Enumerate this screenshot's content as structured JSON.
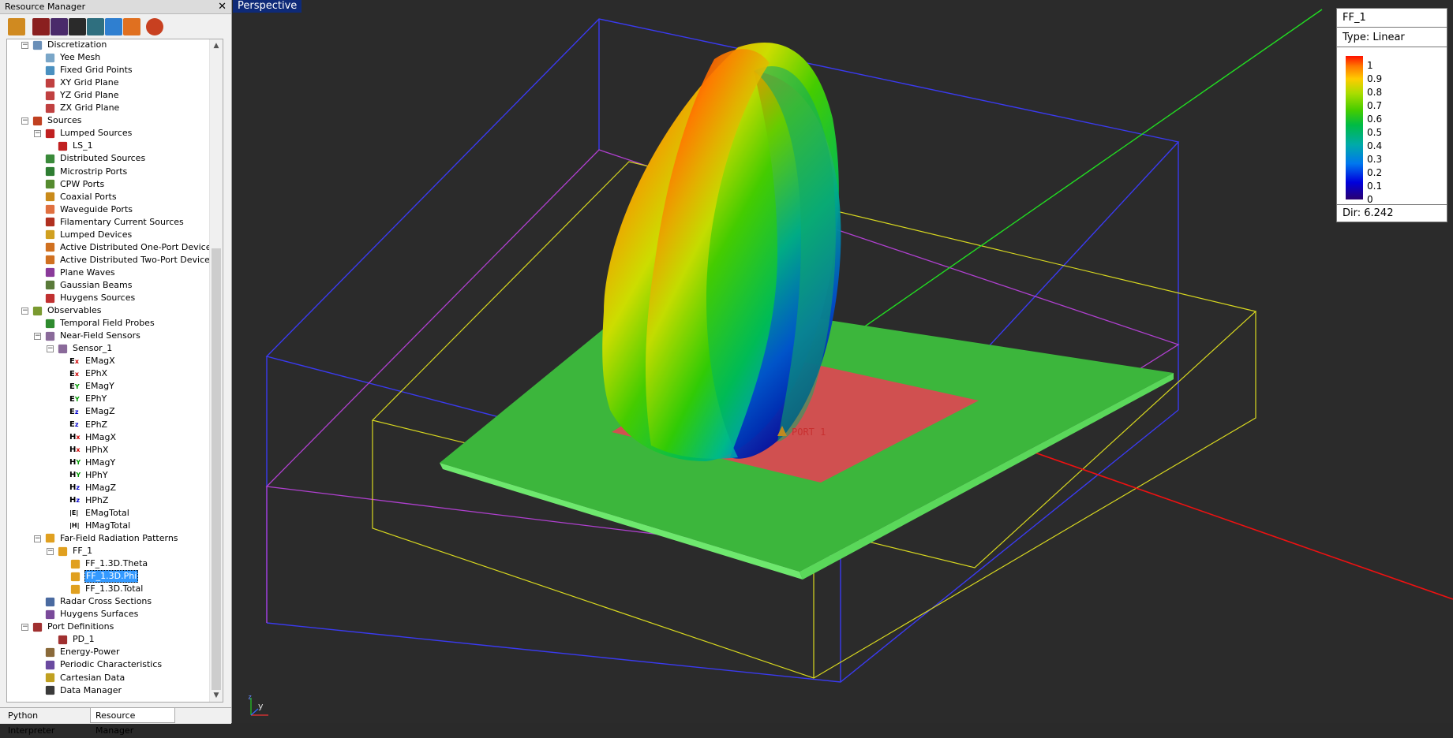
{
  "panel": {
    "title": "Resource Manager",
    "close_glyph": "✕"
  },
  "toolbar": [
    {
      "icon": "open-project-icon"
    },
    {
      "icon": "geometry-view-icon"
    },
    {
      "icon": "mesh-view-icon"
    },
    {
      "icon": "results-view-icon"
    },
    {
      "icon": "network-icon"
    },
    {
      "icon": "scatter-icon"
    },
    {
      "icon": "path-icon"
    },
    {
      "icon": "target-icon"
    }
  ],
  "tree": [
    {
      "depth": 1,
      "label": "Discretization",
      "icon": "grid-icon",
      "exp": "-"
    },
    {
      "depth": 2,
      "label": "Yee Mesh",
      "icon": "yee-mesh-icon"
    },
    {
      "depth": 2,
      "label": "Fixed Grid Points",
      "icon": "grid-points-icon"
    },
    {
      "depth": 2,
      "label": "XY Grid Plane",
      "icon": "axis-plane-icon"
    },
    {
      "depth": 2,
      "label": "YZ Grid Plane",
      "icon": "axis-plane-icon"
    },
    {
      "depth": 2,
      "label": "ZX Grid Plane",
      "icon": "axis-plane-icon"
    },
    {
      "depth": 1,
      "label": "Sources",
      "icon": "source-icon",
      "exp": "-"
    },
    {
      "depth": 2,
      "label": "Lumped Sources",
      "icon": "lumped-source-icon",
      "exp": "-"
    },
    {
      "depth": 3,
      "label": "LS_1",
      "icon": "lumped-source-icon"
    },
    {
      "depth": 2,
      "label": "Distributed Sources",
      "icon": "distributed-source-icon"
    },
    {
      "depth": 2,
      "label": "Microstrip Ports",
      "icon": "microstrip-port-icon"
    },
    {
      "depth": 2,
      "label": "CPW Ports",
      "icon": "cpw-port-icon"
    },
    {
      "depth": 2,
      "label": "Coaxial Ports",
      "icon": "coaxial-port-icon"
    },
    {
      "depth": 2,
      "label": "Waveguide Ports",
      "icon": "waveguide-port-icon"
    },
    {
      "depth": 2,
      "label": "Filamentary Current Sources",
      "icon": "filament-source-icon"
    },
    {
      "depth": 2,
      "label": "Lumped Devices",
      "icon": "lumped-device-icon"
    },
    {
      "depth": 2,
      "label": "Active Distributed One-Port Devices",
      "icon": "active-device-icon"
    },
    {
      "depth": 2,
      "label": "Active Distributed Two-Port Devices",
      "icon": "active-device-icon"
    },
    {
      "depth": 2,
      "label": "Plane Waves",
      "icon": "plane-wave-icon"
    },
    {
      "depth": 2,
      "label": "Gaussian Beams",
      "icon": "gaussian-beam-icon"
    },
    {
      "depth": 2,
      "label": "Huygens Sources",
      "icon": "huygens-source-icon"
    },
    {
      "depth": 1,
      "label": "Observables",
      "icon": "observables-icon",
      "exp": "-"
    },
    {
      "depth": 2,
      "label": "Temporal Field Probes",
      "icon": "field-probe-icon"
    },
    {
      "depth": 2,
      "label": "Near-Field Sensors",
      "icon": "sensor-icon",
      "exp": "-"
    },
    {
      "depth": 3,
      "label": "Sensor_1",
      "icon": "sensor-icon",
      "exp": "-"
    },
    {
      "depth": 4,
      "label": "EMagX",
      "icon": "field-component-icon",
      "sym": "E",
      "sub": "x",
      "col": "#c00"
    },
    {
      "depth": 4,
      "label": "EPhX",
      "icon": "field-component-icon",
      "sym": "E",
      "sub": "x",
      "col": "#c00"
    },
    {
      "depth": 4,
      "label": "EMagY",
      "icon": "field-component-icon",
      "sym": "E",
      "sub": "Y",
      "col": "#090"
    },
    {
      "depth": 4,
      "label": "EPhY",
      "icon": "field-component-icon",
      "sym": "E",
      "sub": "Y",
      "col": "#090"
    },
    {
      "depth": 4,
      "label": "EMagZ",
      "icon": "field-component-icon",
      "sym": "E",
      "sub": "z",
      "col": "#00c"
    },
    {
      "depth": 4,
      "label": "EPhZ",
      "icon": "field-component-icon",
      "sym": "E",
      "sub": "z",
      "col": "#00c"
    },
    {
      "depth": 4,
      "label": "HMagX",
      "icon": "field-component-icon",
      "sym": "H",
      "sub": "x",
      "col": "#c00"
    },
    {
      "depth": 4,
      "label": "HPhX",
      "icon": "field-component-icon",
      "sym": "H",
      "sub": "x",
      "col": "#c00"
    },
    {
      "depth": 4,
      "label": "HMagY",
      "icon": "field-component-icon",
      "sym": "H",
      "sub": "Y",
      "col": "#090"
    },
    {
      "depth": 4,
      "label": "HPhY",
      "icon": "field-component-icon",
      "sym": "H",
      "sub": "Y",
      "col": "#090"
    },
    {
      "depth": 4,
      "label": "HMagZ",
      "icon": "field-component-icon",
      "sym": "H",
      "sub": "z",
      "col": "#00c"
    },
    {
      "depth": 4,
      "label": "HPhZ",
      "icon": "field-component-icon",
      "sym": "H",
      "sub": "z",
      "col": "#00c"
    },
    {
      "depth": 4,
      "label": "EMagTotal",
      "icon": "field-total-icon",
      "sym": "|E|",
      "sub": "",
      "col": "#000"
    },
    {
      "depth": 4,
      "label": "HMagTotal",
      "icon": "field-total-icon",
      "sym": "|H|",
      "sub": "",
      "col": "#000"
    },
    {
      "depth": 2,
      "label": "Far-Field Radiation Patterns",
      "icon": "far-field-icon",
      "exp": "-"
    },
    {
      "depth": 3,
      "label": "FF_1",
      "icon": "far-field-icon",
      "exp": "-"
    },
    {
      "depth": 4,
      "label": "FF_1.3D.Theta",
      "icon": "far-field-icon"
    },
    {
      "depth": 4,
      "label": "FF_1.3D.Phi",
      "icon": "far-field-icon",
      "selected": true
    },
    {
      "depth": 4,
      "label": "FF_1.3D.Total",
      "icon": "far-field-icon"
    },
    {
      "depth": 2,
      "label": "Radar Cross Sections",
      "icon": "radar-icon"
    },
    {
      "depth": 2,
      "label": "Huygens Surfaces",
      "icon": "huygens-surface-icon"
    },
    {
      "depth": 1,
      "label": "Port Definitions",
      "icon": "port-definition-icon",
      "exp": "-",
      "indentAdj": true
    },
    {
      "depth": 3,
      "label": "PD_1",
      "icon": "port-definition-icon"
    },
    {
      "depth": 2,
      "label": "Energy-Power",
      "icon": "energy-icon"
    },
    {
      "depth": 2,
      "label": "Periodic Characteristics",
      "icon": "periodic-icon"
    },
    {
      "depth": 2,
      "label": "Cartesian Data",
      "icon": "cartesian-data-icon"
    },
    {
      "depth": 2,
      "label": "Data Manager",
      "icon": "data-manager-icon"
    }
  ],
  "tabs": {
    "python": "Python Interpreter",
    "resource": "Resource Manager"
  },
  "viewport": {
    "label": "Perspective",
    "port_label": "PORT 1",
    "axis_y": "y",
    "axis_z": "z"
  },
  "legend": {
    "title": "FF_1",
    "type": "Type: Linear",
    "ticks": [
      "1",
      "0.9",
      "0.8",
      "0.7",
      "0.6",
      "0.5",
      "0.4",
      "0.3",
      "0.2",
      "0.1",
      "0"
    ],
    "dir": "Dir: 6.242"
  },
  "colors": {
    "selection": "#3399ff",
    "viewport_bg": "#2b2b2b",
    "label_bg": "#0e2a78"
  }
}
